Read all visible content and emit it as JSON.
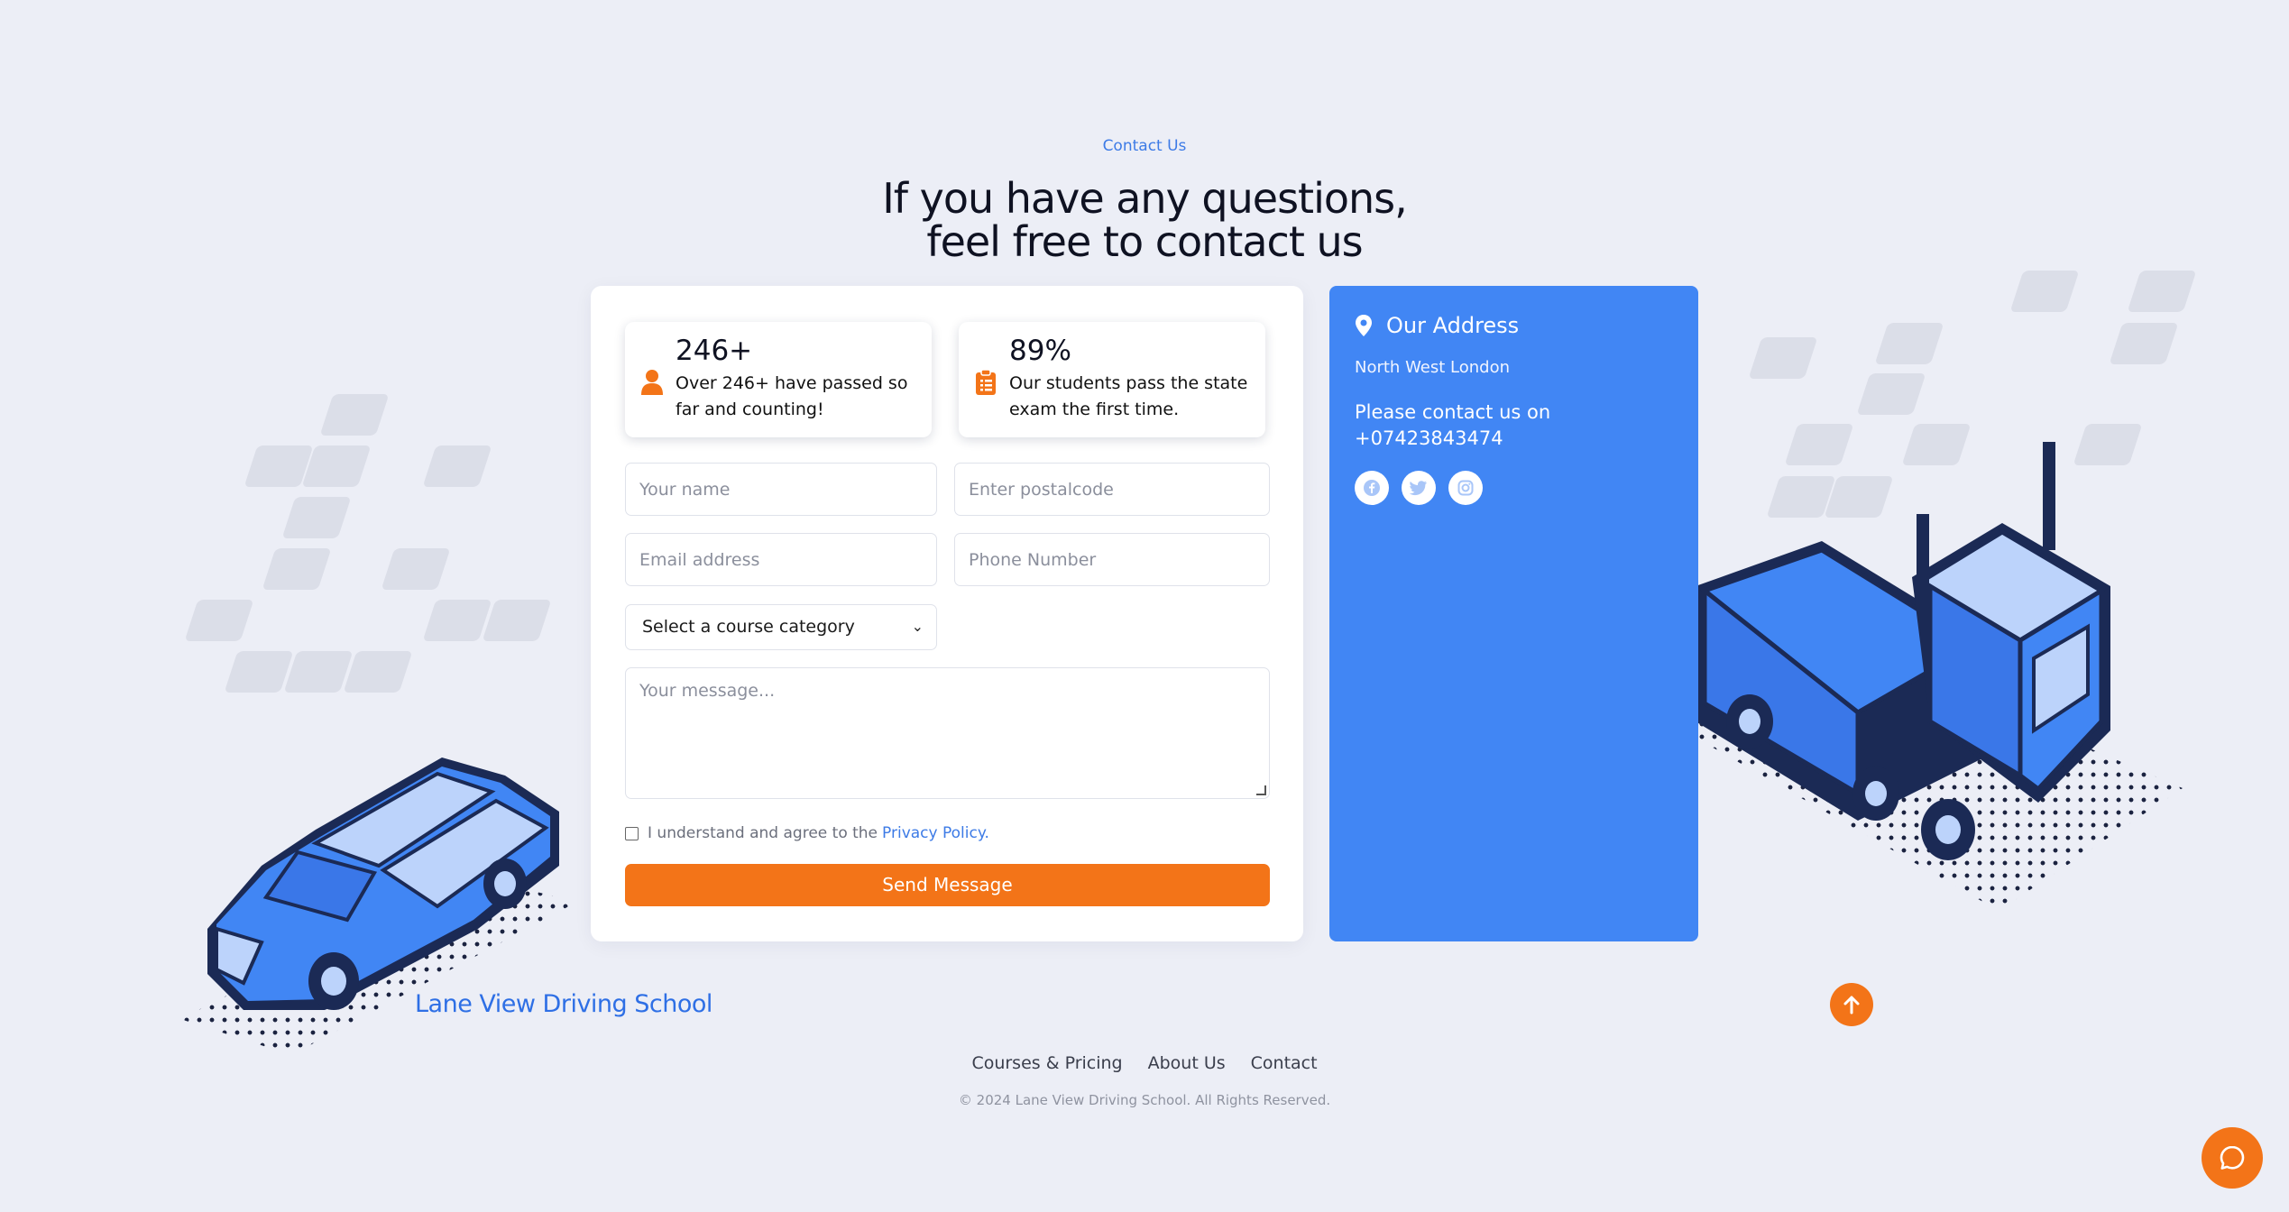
{
  "section": {
    "eyebrow": "Contact Us",
    "heading_line1": "If you have any questions,",
    "heading_line2": "feel free to contact us"
  },
  "stats": [
    {
      "number": "246+",
      "text": "Over 246+ have passed so far and counting!",
      "icon": "person-icon"
    },
    {
      "number": "89%",
      "text": "Our students pass the state exam the first time.",
      "icon": "clipboard-icon"
    }
  ],
  "form": {
    "name_placeholder": "Your name",
    "postcode_placeholder": "Enter postalcode",
    "email_placeholder": "Email address",
    "phone_placeholder": "Phone Number",
    "course_select": "Select a course category",
    "message_placeholder": "Your message...",
    "agree_text": "I understand and agree to the",
    "privacy_link": "Privacy Policy.",
    "submit_label": "Send Message"
  },
  "address": {
    "title": "Our Address",
    "location": "North West London",
    "contact_line": "Please contact us on +07423843474",
    "socials": [
      "facebook-icon",
      "twitter-icon",
      "instagram-icon"
    ]
  },
  "footer": {
    "brand": "Lane View Driving School",
    "nav": [
      "Courses & Pricing",
      "About Us",
      "Contact"
    ],
    "copyright": "© 2024 Lane View Driving School. All Rights Reserved."
  },
  "colors": {
    "accent": "#f37418",
    "blue": "#4186f4",
    "link": "#3d7be6",
    "background": "#eceef6"
  }
}
